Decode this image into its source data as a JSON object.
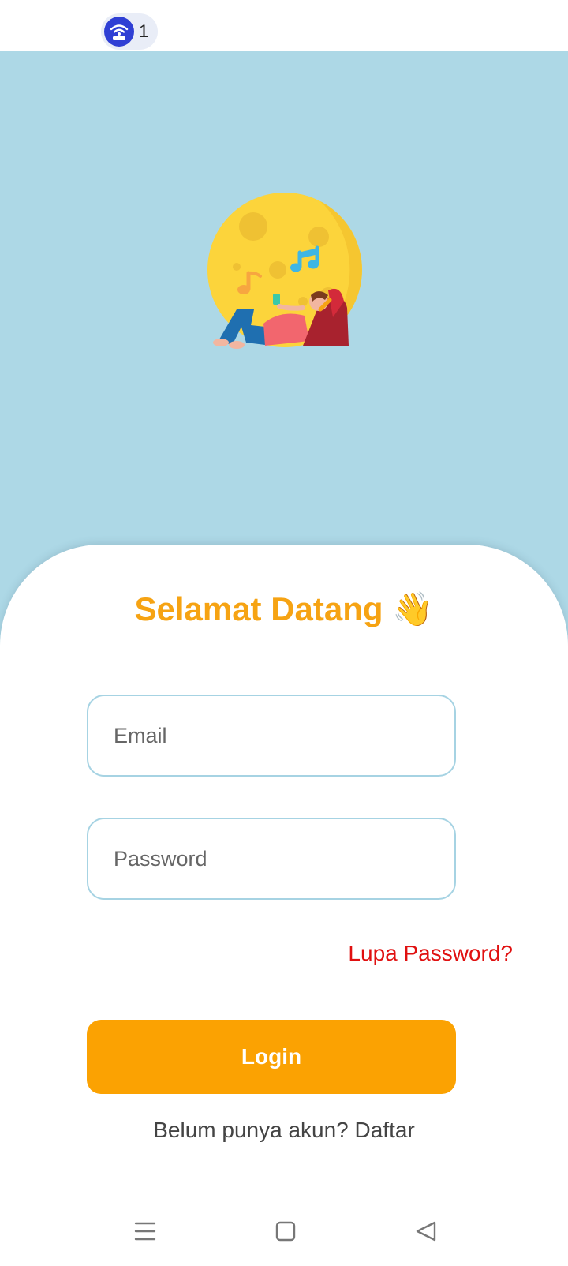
{
  "status_bar": {
    "hotspot_icon": "hotspot-icon",
    "hotspot_count": "1"
  },
  "hero": {
    "illustration": "moon-music-girl-illustration",
    "background_color": "#add8e6"
  },
  "login": {
    "title": "Selamat Datang",
    "title_emoji": "👋",
    "email_placeholder": "Email",
    "email_value": "",
    "password_placeholder": "Password",
    "password_value": "",
    "forgot_password_label": "Lupa Password?",
    "login_button_label": "Login",
    "signup_text": "Belum punya akun? Daftar"
  },
  "colors": {
    "accent": "#fba202",
    "title": "#f6a313",
    "link_red": "#e01010",
    "field_border": "#a6d3e3"
  },
  "nav_bar": {
    "menu_icon": "menu-icon",
    "home_icon": "home-square-icon",
    "back_icon": "back-triangle-icon"
  }
}
